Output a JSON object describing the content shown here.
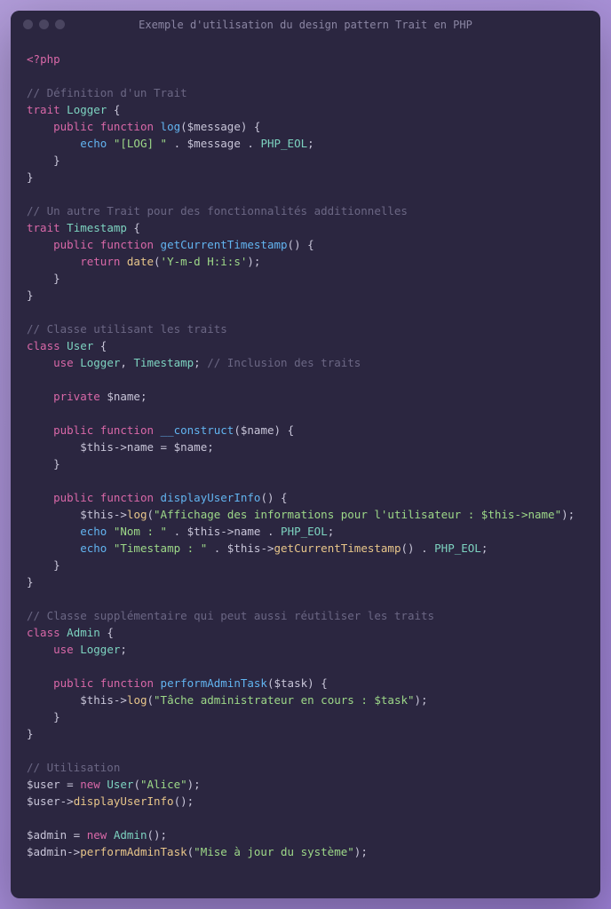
{
  "title": "Exemple d'utilisation du design pattern Trait en PHP",
  "code": {
    "open_tag": "<?",
    "php": "php",
    "c1": "// Définition d'un Trait",
    "trait": "trait",
    "logger": "Logger",
    "public": "public",
    "function": "function",
    "log": "log",
    "message_param": "$message",
    "echo": "echo",
    "log_str": "\"[LOG] \"",
    "php_eol": "PHP_EOL",
    "c2": "// Un autre Trait pour des fonctionnalités additionnelles",
    "timestamp": "Timestamp",
    "getCurrentTimestamp": "getCurrentTimestamp",
    "return": "return",
    "date": "date",
    "date_fmt": "'Y-m-d H:i:s'",
    "c3": "// Classe utilisant les traits",
    "class": "class",
    "user": "User",
    "use": "use",
    "c4": "// Inclusion des traits",
    "private": "private",
    "name_var": "$name",
    "construct": "__construct",
    "name_param": "$name",
    "this": "$this",
    "name_prop": "name",
    "displayUserInfo": "displayUserInfo",
    "log_msg": "\"Affichage des informations pour l'utilisateur : $this->name\"",
    "nom_str": "\"Nom : \"",
    "ts_str": "\"Timestamp : \"",
    "c5": "// Classe supplémentaire qui peut aussi réutiliser les traits",
    "admin": "Admin",
    "performAdminTask": "performAdminTask",
    "task_param": "$task",
    "admin_msg": "\"Tâche administrateur en cours : $task\"",
    "c6": "// Utilisation",
    "user_var": "$user",
    "new": "new",
    "alice": "\"Alice\"",
    "admin_var": "$admin",
    "mise": "\"Mise à jour du système\""
  }
}
